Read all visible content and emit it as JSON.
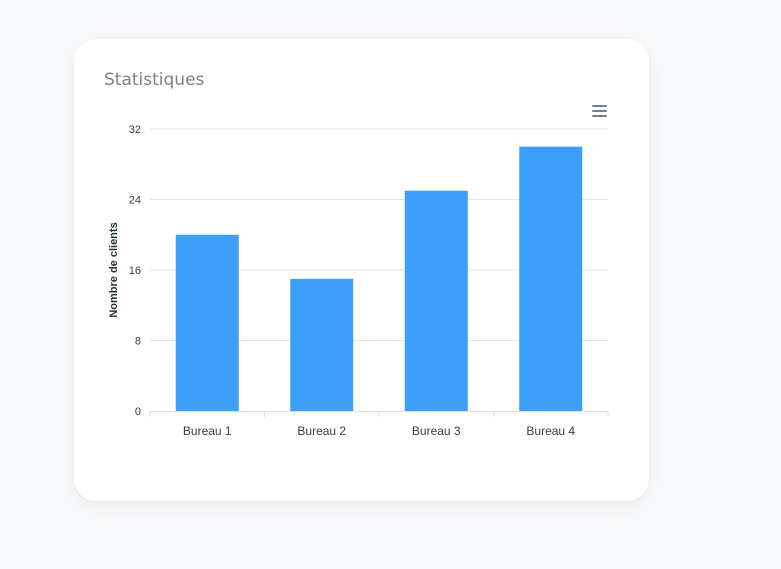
{
  "card": {
    "title": "Statistiques"
  },
  "toolbar": {
    "menu_icon": "hamburger-menu-icon"
  },
  "colors": {
    "bar": "#3ca0fb",
    "grid": "#e6e6e6",
    "axis": "#e0e0e0"
  },
  "chart_data": {
    "type": "bar",
    "title": "Statistiques",
    "categories": [
      "Bureau 1",
      "Bureau 2",
      "Bureau 3",
      "Bureau 4"
    ],
    "values": [
      20,
      15,
      25,
      30
    ],
    "ylabel": "Nombre de clients",
    "xlabel": "",
    "ylim": [
      0,
      32
    ],
    "yticks": [
      0,
      8,
      16,
      24,
      32
    ],
    "grid": true,
    "legend": "none"
  }
}
